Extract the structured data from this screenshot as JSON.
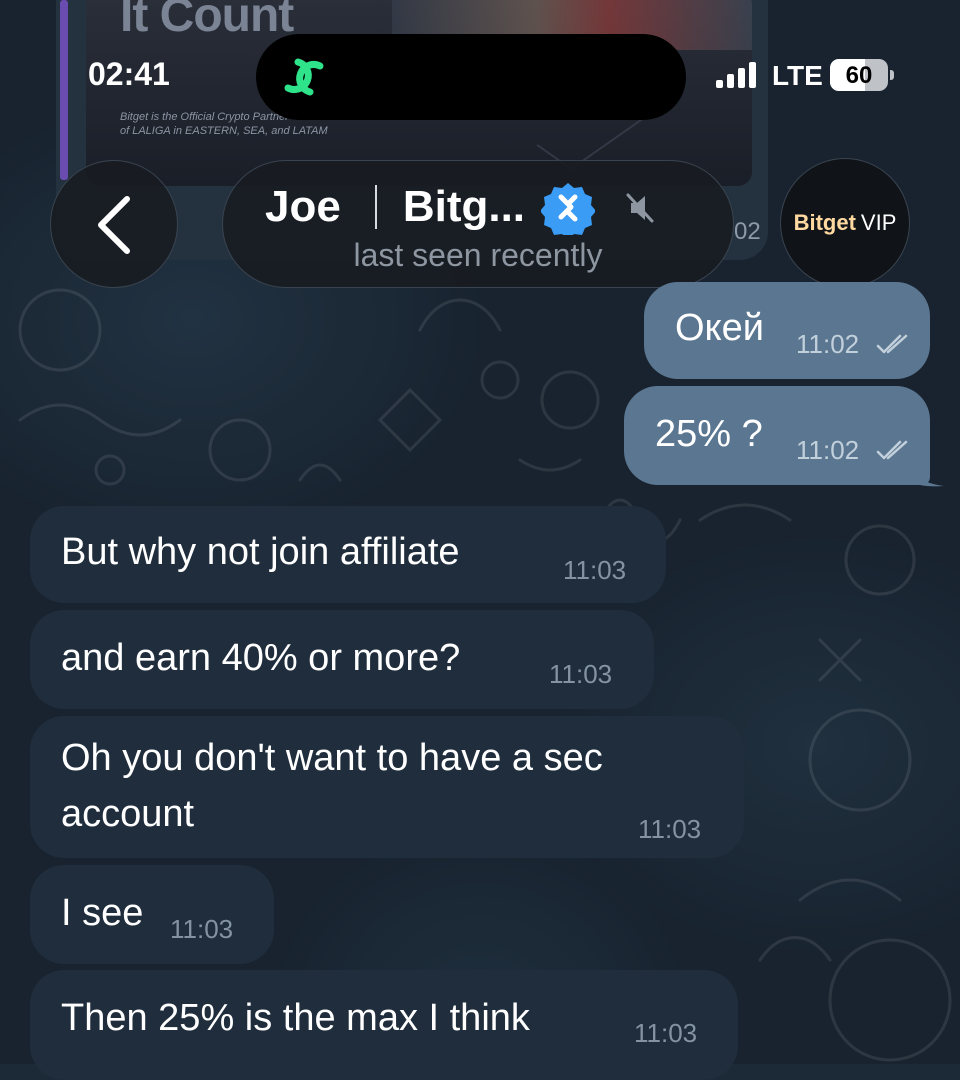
{
  "status_bar": {
    "time": "02:41",
    "network": "LTE",
    "battery_level": "60",
    "battery_fraction": 0.6
  },
  "media": {
    "headline": "It Count",
    "subline1": "Bitget is the Official Crypto Partner",
    "subline2": "of LALIGA in EASTERN, SEA, and LATAM",
    "time": "02"
  },
  "header": {
    "name": "Joe",
    "company": "Bitg...",
    "status": "last seen recently",
    "avatar_brand": "Bitget",
    "avatar_suffix": "VIP"
  },
  "messages": [
    {
      "direction": "out",
      "text": "Окей",
      "time": "11:02",
      "read": true
    },
    {
      "direction": "out",
      "text": "25% ?",
      "time": "11:02",
      "read": true
    },
    {
      "direction": "in",
      "text": "But why not join affiliate",
      "time": "11:03"
    },
    {
      "direction": "in",
      "text": "and earn 40% or more?",
      "time": "11:03"
    },
    {
      "direction": "in",
      "text_line1": "Oh you don't want to have a sec",
      "text_line2": "account",
      "time": "11:03"
    },
    {
      "direction": "in",
      "text": "I see",
      "time": "11:03"
    },
    {
      "direction": "in",
      "text": "Then 25% is the max I think",
      "time": "11:03"
    }
  ],
  "colors": {
    "outgoing_bubble": "#5b7690",
    "incoming_bubble": "#1f2d3c",
    "verified_badge": "#3b9cf5",
    "avatar_brand": "#ffd9a0"
  }
}
